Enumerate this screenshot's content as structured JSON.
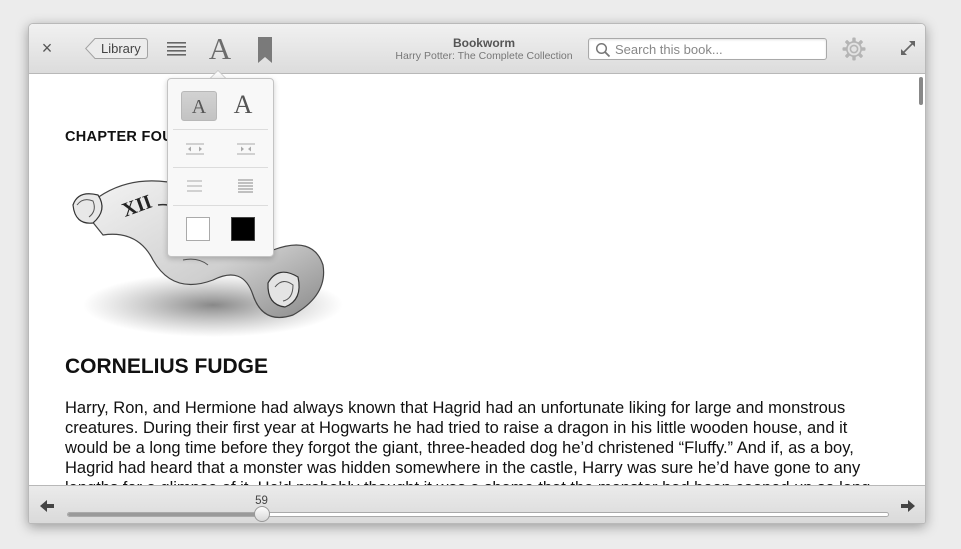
{
  "header": {
    "close_glyph": "×",
    "library_label": "Library",
    "font_glyph": "A",
    "title": "Bookworm",
    "subtitle": "Harry Potter: The Complete Collection",
    "search_placeholder": "Search this book...",
    "search_value": ""
  },
  "font_popover": {
    "decrease_glyph": "A",
    "increase_glyph": "A",
    "decrease_selected": true,
    "colors": {
      "light_theme": "#ffffff",
      "dark_theme": "#000000"
    }
  },
  "content": {
    "chapter_label": "CHAPTER  FOUR",
    "chapter_title": "CORNELIUS FUDGE",
    "paragraph": "Harry, Ron, and Hermione had always known that Hagrid had an unfortunate liking for large and monstrous creatures. During their first year at Hogwarts he had tried to raise a dragon in his little wooden house, and it would be a long time before they forgot the giant, three-headed dog he’d christened “Fluffy.” And if, as a boy, Hagrid had heard that a monster was hidden somewhere in the castle, Harry was sure he’d have gone to any lengths for a glimpse of it. He’d probably thought it was a shame that the monster had been cooped up so long, and thought it deserved the chance to stretch its many legs."
  },
  "footer": {
    "page": "59",
    "progress_fraction": 0.236
  }
}
